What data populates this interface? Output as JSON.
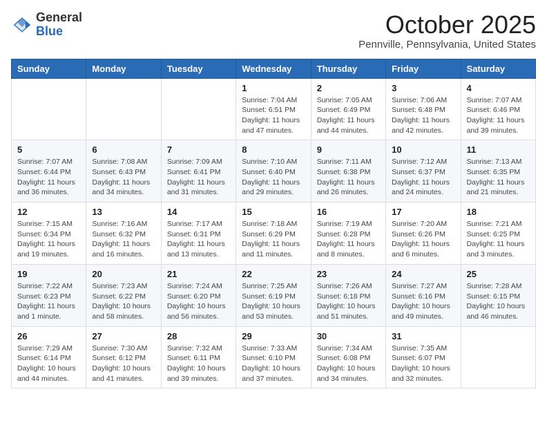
{
  "logo": {
    "general": "General",
    "blue": "Blue"
  },
  "header": {
    "month": "October 2025",
    "subtitle": "Pennville, Pennsylvania, United States"
  },
  "weekdays": [
    "Sunday",
    "Monday",
    "Tuesday",
    "Wednesday",
    "Thursday",
    "Friday",
    "Saturday"
  ],
  "weeks": [
    [
      {
        "day": "",
        "info": ""
      },
      {
        "day": "",
        "info": ""
      },
      {
        "day": "",
        "info": ""
      },
      {
        "day": "1",
        "info": "Sunrise: 7:04 AM\nSunset: 6:51 PM\nDaylight: 11 hours and 47 minutes."
      },
      {
        "day": "2",
        "info": "Sunrise: 7:05 AM\nSunset: 6:49 PM\nDaylight: 11 hours and 44 minutes."
      },
      {
        "day": "3",
        "info": "Sunrise: 7:06 AM\nSunset: 6:48 PM\nDaylight: 11 hours and 42 minutes."
      },
      {
        "day": "4",
        "info": "Sunrise: 7:07 AM\nSunset: 6:46 PM\nDaylight: 11 hours and 39 minutes."
      }
    ],
    [
      {
        "day": "5",
        "info": "Sunrise: 7:07 AM\nSunset: 6:44 PM\nDaylight: 11 hours and 36 minutes."
      },
      {
        "day": "6",
        "info": "Sunrise: 7:08 AM\nSunset: 6:43 PM\nDaylight: 11 hours and 34 minutes."
      },
      {
        "day": "7",
        "info": "Sunrise: 7:09 AM\nSunset: 6:41 PM\nDaylight: 11 hours and 31 minutes."
      },
      {
        "day": "8",
        "info": "Sunrise: 7:10 AM\nSunset: 6:40 PM\nDaylight: 11 hours and 29 minutes."
      },
      {
        "day": "9",
        "info": "Sunrise: 7:11 AM\nSunset: 6:38 PM\nDaylight: 11 hours and 26 minutes."
      },
      {
        "day": "10",
        "info": "Sunrise: 7:12 AM\nSunset: 6:37 PM\nDaylight: 11 hours and 24 minutes."
      },
      {
        "day": "11",
        "info": "Sunrise: 7:13 AM\nSunset: 6:35 PM\nDaylight: 11 hours and 21 minutes."
      }
    ],
    [
      {
        "day": "12",
        "info": "Sunrise: 7:15 AM\nSunset: 6:34 PM\nDaylight: 11 hours and 19 minutes."
      },
      {
        "day": "13",
        "info": "Sunrise: 7:16 AM\nSunset: 6:32 PM\nDaylight: 11 hours and 16 minutes."
      },
      {
        "day": "14",
        "info": "Sunrise: 7:17 AM\nSunset: 6:31 PM\nDaylight: 11 hours and 13 minutes."
      },
      {
        "day": "15",
        "info": "Sunrise: 7:18 AM\nSunset: 6:29 PM\nDaylight: 11 hours and 11 minutes."
      },
      {
        "day": "16",
        "info": "Sunrise: 7:19 AM\nSunset: 6:28 PM\nDaylight: 11 hours and 8 minutes."
      },
      {
        "day": "17",
        "info": "Sunrise: 7:20 AM\nSunset: 6:26 PM\nDaylight: 11 hours and 6 minutes."
      },
      {
        "day": "18",
        "info": "Sunrise: 7:21 AM\nSunset: 6:25 PM\nDaylight: 11 hours and 3 minutes."
      }
    ],
    [
      {
        "day": "19",
        "info": "Sunrise: 7:22 AM\nSunset: 6:23 PM\nDaylight: 11 hours and 1 minute."
      },
      {
        "day": "20",
        "info": "Sunrise: 7:23 AM\nSunset: 6:22 PM\nDaylight: 10 hours and 58 minutes."
      },
      {
        "day": "21",
        "info": "Sunrise: 7:24 AM\nSunset: 6:20 PM\nDaylight: 10 hours and 56 minutes."
      },
      {
        "day": "22",
        "info": "Sunrise: 7:25 AM\nSunset: 6:19 PM\nDaylight: 10 hours and 53 minutes."
      },
      {
        "day": "23",
        "info": "Sunrise: 7:26 AM\nSunset: 6:18 PM\nDaylight: 10 hours and 51 minutes."
      },
      {
        "day": "24",
        "info": "Sunrise: 7:27 AM\nSunset: 6:16 PM\nDaylight: 10 hours and 49 minutes."
      },
      {
        "day": "25",
        "info": "Sunrise: 7:28 AM\nSunset: 6:15 PM\nDaylight: 10 hours and 46 minutes."
      }
    ],
    [
      {
        "day": "26",
        "info": "Sunrise: 7:29 AM\nSunset: 6:14 PM\nDaylight: 10 hours and 44 minutes."
      },
      {
        "day": "27",
        "info": "Sunrise: 7:30 AM\nSunset: 6:12 PM\nDaylight: 10 hours and 41 minutes."
      },
      {
        "day": "28",
        "info": "Sunrise: 7:32 AM\nSunset: 6:11 PM\nDaylight: 10 hours and 39 minutes."
      },
      {
        "day": "29",
        "info": "Sunrise: 7:33 AM\nSunset: 6:10 PM\nDaylight: 10 hours and 37 minutes."
      },
      {
        "day": "30",
        "info": "Sunrise: 7:34 AM\nSunset: 6:08 PM\nDaylight: 10 hours and 34 minutes."
      },
      {
        "day": "31",
        "info": "Sunrise: 7:35 AM\nSunset: 6:07 PM\nDaylight: 10 hours and 32 minutes."
      },
      {
        "day": "",
        "info": ""
      }
    ]
  ]
}
